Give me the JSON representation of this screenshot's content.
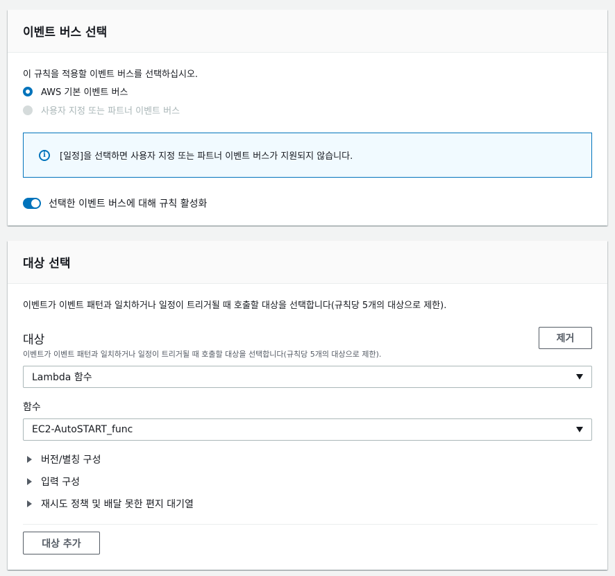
{
  "event_bus": {
    "title": "이벤트 버스 선택",
    "description": "이 규칙을 적용할 이벤트 버스를 선택하십시오.",
    "options": [
      {
        "label": "AWS 기본 이벤트 버스",
        "selected": true,
        "disabled": false
      },
      {
        "label": "사용자 지정 또는 파트너 이벤트 버스",
        "selected": false,
        "disabled": true
      }
    ],
    "alert_text": "[일정]을 선택하면 사용자 지정 또는 파트너 이벤트 버스가 지원되지 않습니다.",
    "toggle_label": "선택한 이벤트 버스에 대해 규칙 활성화",
    "toggle_on": true
  },
  "target": {
    "title": "대상 선택",
    "description": "이벤트가 이벤트 패턴과 일치하거나 일정이 트리거될 때 호출할 대상을 선택합니다(규칙당 5개의 대상으로 제한).",
    "target_label": "대상",
    "target_sublabel": "이벤트가 이벤트 패턴과 일치하거나 일정이 트리거될 때 호출할 대상을 선택합니다(규칙당 5개의 대상으로 제한).",
    "remove_label": "제거",
    "target_type_value": "Lambda 함수",
    "function_label": "함수",
    "function_value": "EC2-AutoSTART_func",
    "expanders": [
      {
        "label": "버전/별칭 구성"
      },
      {
        "label": "입력 구성"
      },
      {
        "label": "재시도 정책 및 배달 못한 편지 대기열"
      }
    ],
    "add_target_label": "대상 추가"
  },
  "colors": {
    "accent": "#0073bb",
    "alert_bg": "#f1faff",
    "header_bg": "#fafafa",
    "page_bg": "#f2f3f3"
  }
}
